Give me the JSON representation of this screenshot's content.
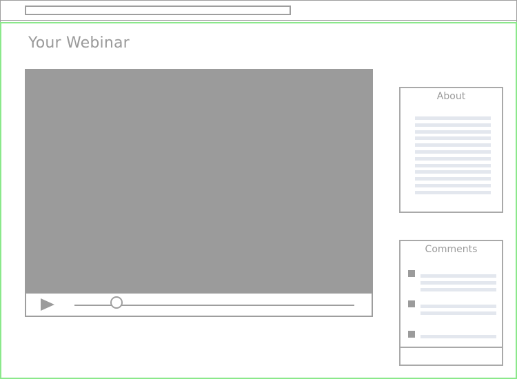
{
  "browser": {
    "address_bar_value": ""
  },
  "page": {
    "title": "Your Webinar"
  },
  "video_player": {
    "progress_fraction": 0.15,
    "play_icon": "play-icon"
  },
  "about_panel": {
    "heading": "About"
  },
  "comments_panel": {
    "heading": "Comments",
    "comment_input_value": ""
  },
  "colors": {
    "frame_border": "#9e9e9e",
    "viewport_border": "#8be88b",
    "video_screen": "#9b9b9b",
    "placeholder_text_line": "#e3e7ee",
    "heading_text": "#9a9a9a"
  }
}
